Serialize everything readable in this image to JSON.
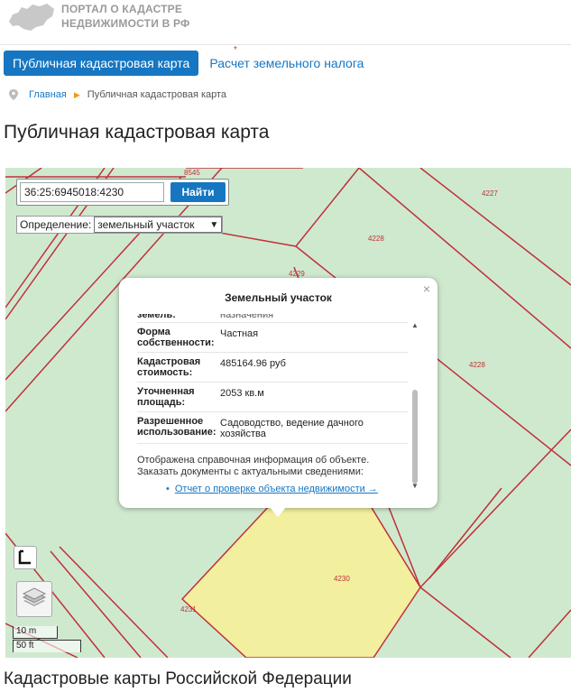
{
  "header": {
    "logo_line1": "ПОРТАЛ О КАДАСТРЕ",
    "logo_line2": "НЕДВИЖИМОСТИ В РФ"
  },
  "tabs": [
    {
      "label": "Публичная кадастровая карта",
      "active": true
    },
    {
      "label": "Расчет земельного налога",
      "active": false
    }
  ],
  "breadcrumb": {
    "home": "Главная",
    "current": "Публичная кадастровая карта"
  },
  "page_title": "Публичная кадастровая карта",
  "map": {
    "search": {
      "value": "36:25:6945018:4230",
      "button": "Найти"
    },
    "definition": {
      "label": "Определение:",
      "selected": "земельный участок"
    },
    "parcel_labels": [
      "8545",
      "4227",
      "4228",
      "4229",
      "4228",
      "4230",
      "4231"
    ],
    "scale": {
      "metric": "10 m",
      "imperial": "50 ft"
    }
  },
  "popup": {
    "title": "Земельный участок",
    "close": "×",
    "cut_row": {
      "key": "земель:",
      "value": "назначения"
    },
    "rows": [
      {
        "key": "Форма собственности:",
        "value": "Частная"
      },
      {
        "key": "Кадастровая стоимость:",
        "value": "485164.96 руб"
      },
      {
        "key": "Уточненная площадь:",
        "value": "2053 кв.м"
      },
      {
        "key": "Разрешенное использование:",
        "value": "Садоводство, ведение дачного хозяйства"
      }
    ],
    "note": "Отображена справочная информация об объекте. Заказать документы с актуальными сведениями:",
    "link": "Отчет о проверке объекта недвижимости →"
  },
  "section_title": "Кадастровые карты Российской Федерации",
  "colors": {
    "accent": "#1676c2",
    "map_bg": "#cfe9cf",
    "parcel_line": "#c0303a",
    "selected_parcel": "#f2ef9e"
  }
}
